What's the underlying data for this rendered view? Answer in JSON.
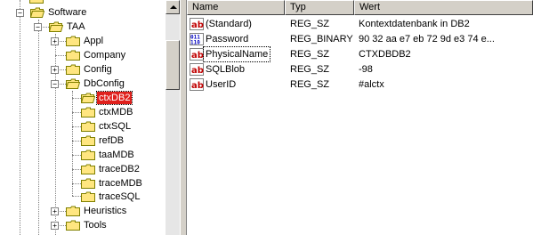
{
  "tree": {
    "items": [
      {
        "label": "Software",
        "expander": "−"
      },
      {
        "label": "TAA",
        "expander": "−"
      },
      {
        "label": "Appl",
        "expander": "+"
      },
      {
        "label": "Company",
        "expander": ""
      },
      {
        "label": "Config",
        "expander": "+"
      },
      {
        "label": "DbConfig",
        "expander": "−"
      },
      {
        "label": "ctxDB2",
        "expander": "",
        "selected": true
      },
      {
        "label": "ctxMDB",
        "expander": ""
      },
      {
        "label": "ctxSQL",
        "expander": ""
      },
      {
        "label": "refDB",
        "expander": ""
      },
      {
        "label": "taaMDB",
        "expander": ""
      },
      {
        "label": "traceDB2",
        "expander": ""
      },
      {
        "label": "traceMDB",
        "expander": ""
      },
      {
        "label": "traceSQL",
        "expander": ""
      },
      {
        "label": "Heuristics",
        "expander": "+"
      },
      {
        "label": "Tools",
        "expander": "+"
      }
    ]
  },
  "list": {
    "columns": {
      "name": "Name",
      "type": "Typ",
      "value": "Wert"
    },
    "rows": [
      {
        "name": "(Standard)",
        "type": "REG_SZ",
        "value": "Kontextdatenbank in DB2",
        "icon": "string-value-icon"
      },
      {
        "name": "Password",
        "type": "REG_BINARY",
        "value": "90 32 aa e7 eb 72 9d e3 74 e...",
        "icon": "binary-value-icon"
      },
      {
        "name": "PhysicalName",
        "type": "REG_SZ",
        "value": "CTXDBDB2",
        "icon": "string-value-icon"
      },
      {
        "name": "SQLBlob",
        "type": "REG_SZ",
        "value": "-98",
        "icon": "string-value-icon"
      },
      {
        "name": "UserID",
        "type": "REG_SZ",
        "value": "#alctx",
        "icon": "string-value-icon"
      }
    ]
  },
  "colors": {
    "selection": "#e0201c",
    "folder": "#ffe680",
    "chrome": "#d4d0c8"
  }
}
